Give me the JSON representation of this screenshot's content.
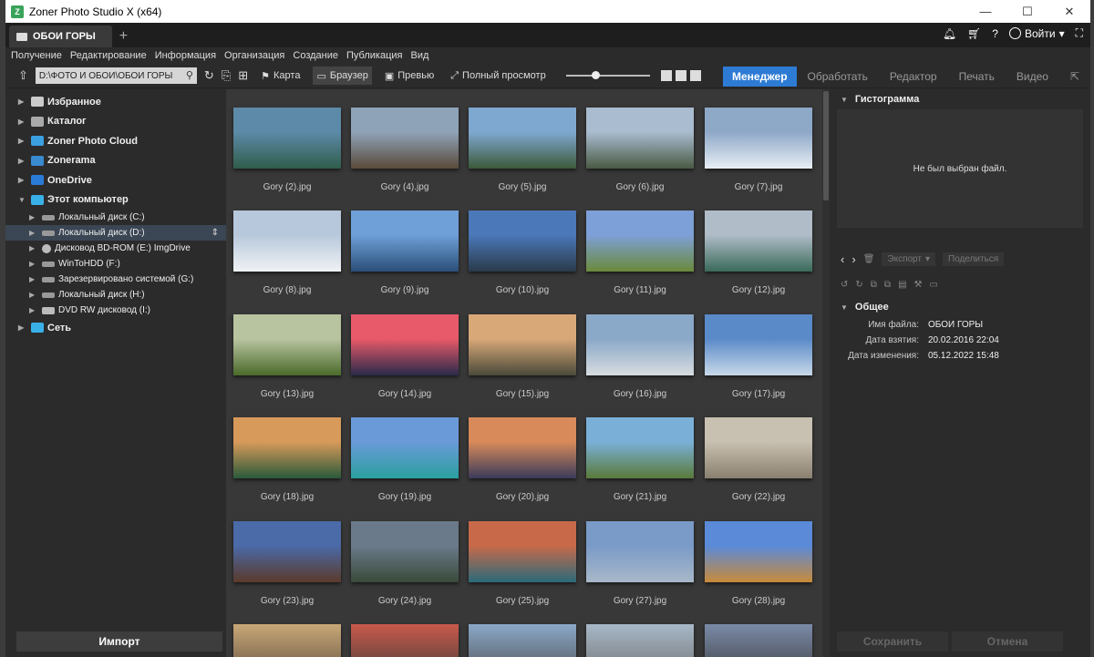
{
  "window": {
    "title": "Zoner Photo Studio X (x64)",
    "minimize": "—",
    "maximize": "☐",
    "close": "✕"
  },
  "tab": {
    "label": "ОБОИ ГОРЫ",
    "add": "+"
  },
  "header_right": {
    "login_label": "Войти"
  },
  "menu": [
    "Получение",
    "Редактирование",
    "Информация",
    "Организация",
    "Создание",
    "Публикация",
    "Вид"
  ],
  "toolbar": {
    "path": "D:\\ФОТО И ОБОИ\\ОБОИ ГОРЫ",
    "views": [
      "Карта",
      "Браузер",
      "Превью",
      "Полный просмотр"
    ],
    "active_view": "Браузер"
  },
  "modes": [
    "Менеджер",
    "Обработать",
    "Редактор",
    "Печать",
    "Видео"
  ],
  "active_mode": "Менеджер",
  "tree": {
    "roots": [
      "Избранное",
      "Каталог",
      "Zoner Photo Cloud",
      "Zonerama",
      "OneDrive",
      "Этот компьютер"
    ],
    "drives": [
      "Локальный диск (C:)",
      "Локальный диск (D:)",
      "Дисковод BD-ROM (E:) ImgDrive",
      "WinToHDD (F:)",
      "Зарезервировано системой (G:)",
      "Локальный диск (H:)",
      "DVD RW дисковод (I:)"
    ],
    "selected_drive": "Локальный диск (D:)",
    "network": "Сеть"
  },
  "import_label": "Импорт",
  "thumbnails": [
    "Gory (2).jpg",
    "Gory (4).jpg",
    "Gory (5).jpg",
    "Gory (6).jpg",
    "Gory (7).jpg",
    "Gory (8).jpg",
    "Gory (9).jpg",
    "Gory (10).jpg",
    "Gory (11).jpg",
    "Gory (12).jpg",
    "Gory (13).jpg",
    "Gory (14).jpg",
    "Gory (15).jpg",
    "Gory (16).jpg",
    "Gory (17).jpg",
    "Gory (18).jpg",
    "Gory (19).jpg",
    "Gory (20).jpg",
    "Gory (21).jpg",
    "Gory (22).jpg",
    "Gory (23).jpg",
    "Gory (24).jpg",
    "Gory (25).jpg",
    "Gory (27).jpg",
    "Gory (28).jpg"
  ],
  "thumb_colors": [
    [
      "#5d8aa8",
      "#2f5d4a"
    ],
    [
      "#8fa3b8",
      "#5a4a3a"
    ],
    [
      "#7fa8d0",
      "#3c5a3a"
    ],
    [
      "#a9bcd0",
      "#4a5a44"
    ],
    [
      "#8ea8c8",
      "#e8eef4"
    ],
    [
      "#b8c8dc",
      "#f0f2f5"
    ],
    [
      "#6fa0d8",
      "#2a4e78"
    ],
    [
      "#4a78b8",
      "#2a3a4a"
    ],
    [
      "#7ea0d8",
      "#6a8a3a"
    ],
    [
      "#b0bcc8",
      "#3a6a5a"
    ],
    [
      "#b8c4a0",
      "#4a6a2a"
    ],
    [
      "#e85a6a",
      "#2a2a4a"
    ],
    [
      "#d8a878",
      "#4a4a3a"
    ],
    [
      "#8aa8c8",
      "#d8dce0"
    ],
    [
      "#5a8ac8",
      "#c8d8e8"
    ],
    [
      "#d89a5a",
      "#2a5a3a"
    ],
    [
      "#6a9ad8",
      "#2aa0a0"
    ],
    [
      "#d88a5a",
      "#3a3a5a"
    ],
    [
      "#7ab0d8",
      "#5a7a3a"
    ],
    [
      "#c8c0b0",
      "#8a8070"
    ],
    [
      "#4a6aa8",
      "#5a3a2a"
    ],
    [
      "#6a7a8a",
      "#3a4a3a"
    ],
    [
      "#c86a4a",
      "#2a6a7a"
    ],
    [
      "#7a9ac8",
      "#a8b8c8"
    ],
    [
      "#5a8ad8",
      "#c88a3a"
    ]
  ],
  "bottom_partial_colors": [
    [
      "#c8a878",
      "#5a4a3a"
    ],
    [
      "#c85a4a",
      "#3a3a3a"
    ],
    [
      "#8aa8c8",
      "#4a4a4a"
    ],
    [
      "#a8b8c8",
      "#6a6a6a"
    ],
    [
      "#7a8aa8",
      "#3a3a3a"
    ]
  ],
  "right_panel": {
    "histogram_title": "Гистограмма",
    "no_file": "Не был выбран файл.",
    "export_label": "Экспорт",
    "share_label": "Поделиться",
    "general_title": "Общее",
    "props": [
      {
        "k": "Имя файла:",
        "v": "ОБОИ ГОРЫ"
      },
      {
        "k": "Дата взятия:",
        "v": "20.02.2016 22:04"
      },
      {
        "k": "Дата изменения:",
        "v": "05.12.2022 15:48"
      }
    ],
    "save_label": "Сохранить",
    "cancel_label": "Отмена"
  }
}
